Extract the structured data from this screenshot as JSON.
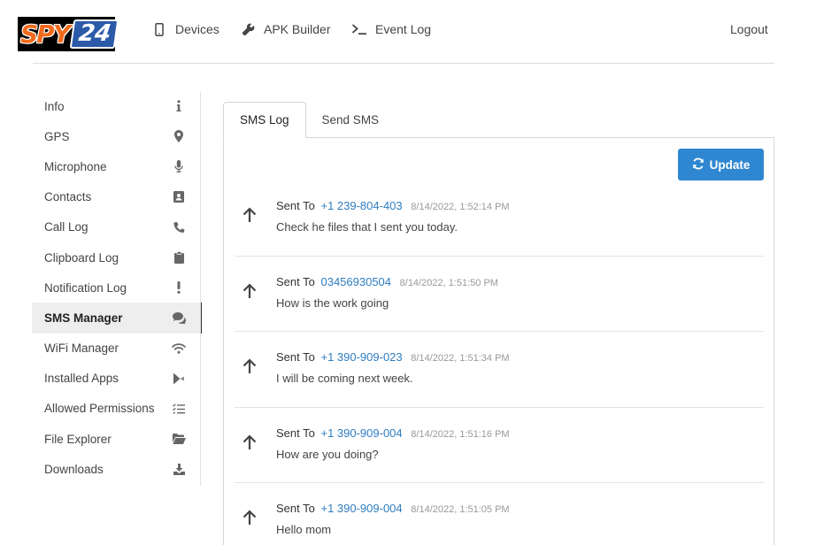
{
  "logo": {
    "part1": "SPY",
    "part2": "24"
  },
  "nav": {
    "devices": "Devices",
    "apk_builder": "APK Builder",
    "event_log": "Event Log",
    "logout": "Logout"
  },
  "sidebar": {
    "items": [
      {
        "label": "Info",
        "icon": "info-icon"
      },
      {
        "label": "GPS",
        "icon": "map-pin-icon"
      },
      {
        "label": "Microphone",
        "icon": "microphone-icon"
      },
      {
        "label": "Contacts",
        "icon": "contact-card-icon"
      },
      {
        "label": "Call Log",
        "icon": "phone-icon"
      },
      {
        "label": "Clipboard Log",
        "icon": "clipboard-icon"
      },
      {
        "label": "Notification Log",
        "icon": "exclamation-icon"
      },
      {
        "label": "SMS Manager",
        "icon": "chat-bubbles-icon",
        "active": true
      },
      {
        "label": "WiFi Manager",
        "icon": "wifi-icon"
      },
      {
        "label": "Installed Apps",
        "icon": "play-store-icon"
      },
      {
        "label": "Allowed Permissions",
        "icon": "checklist-icon"
      },
      {
        "label": "File Explorer",
        "icon": "folder-open-icon"
      },
      {
        "label": "Downloads",
        "icon": "download-icon"
      }
    ]
  },
  "tabs": [
    {
      "label": "SMS Log",
      "active": true
    },
    {
      "label": "Send SMS",
      "active": false
    }
  ],
  "update_button": {
    "label": "Update",
    "icon": "refresh-icon"
  },
  "messages": [
    {
      "direction": "sent",
      "prefix": "Sent To",
      "phone": "+1 239-804-403",
      "time": "8/14/2022, 1:52:14 PM",
      "text": "Check he files that I sent you today."
    },
    {
      "direction": "sent",
      "prefix": "Sent To",
      "phone": "03456930504",
      "time": "8/14/2022, 1:51:50 PM",
      "text": "How is the work going"
    },
    {
      "direction": "sent",
      "prefix": "Sent To",
      "phone": "+1 390-909-023",
      "time": "8/14/2022, 1:51:34 PM",
      "text": "I will be coming next week."
    },
    {
      "direction": "sent",
      "prefix": "Sent To",
      "phone": "+1 390-909-004",
      "time": "8/14/2022, 1:51:16 PM",
      "text": "How are you doing?"
    },
    {
      "direction": "sent",
      "prefix": "Sent To",
      "phone": "+1 390-909-004",
      "time": "8/14/2022, 1:51:05 PM",
      "text": "Hello mom"
    }
  ],
  "colors": {
    "accent": "#2f87d1",
    "phone_link": "#2f7dc0",
    "logo_orange": "#f26b1d",
    "logo_blue": "#2b5aa8"
  }
}
